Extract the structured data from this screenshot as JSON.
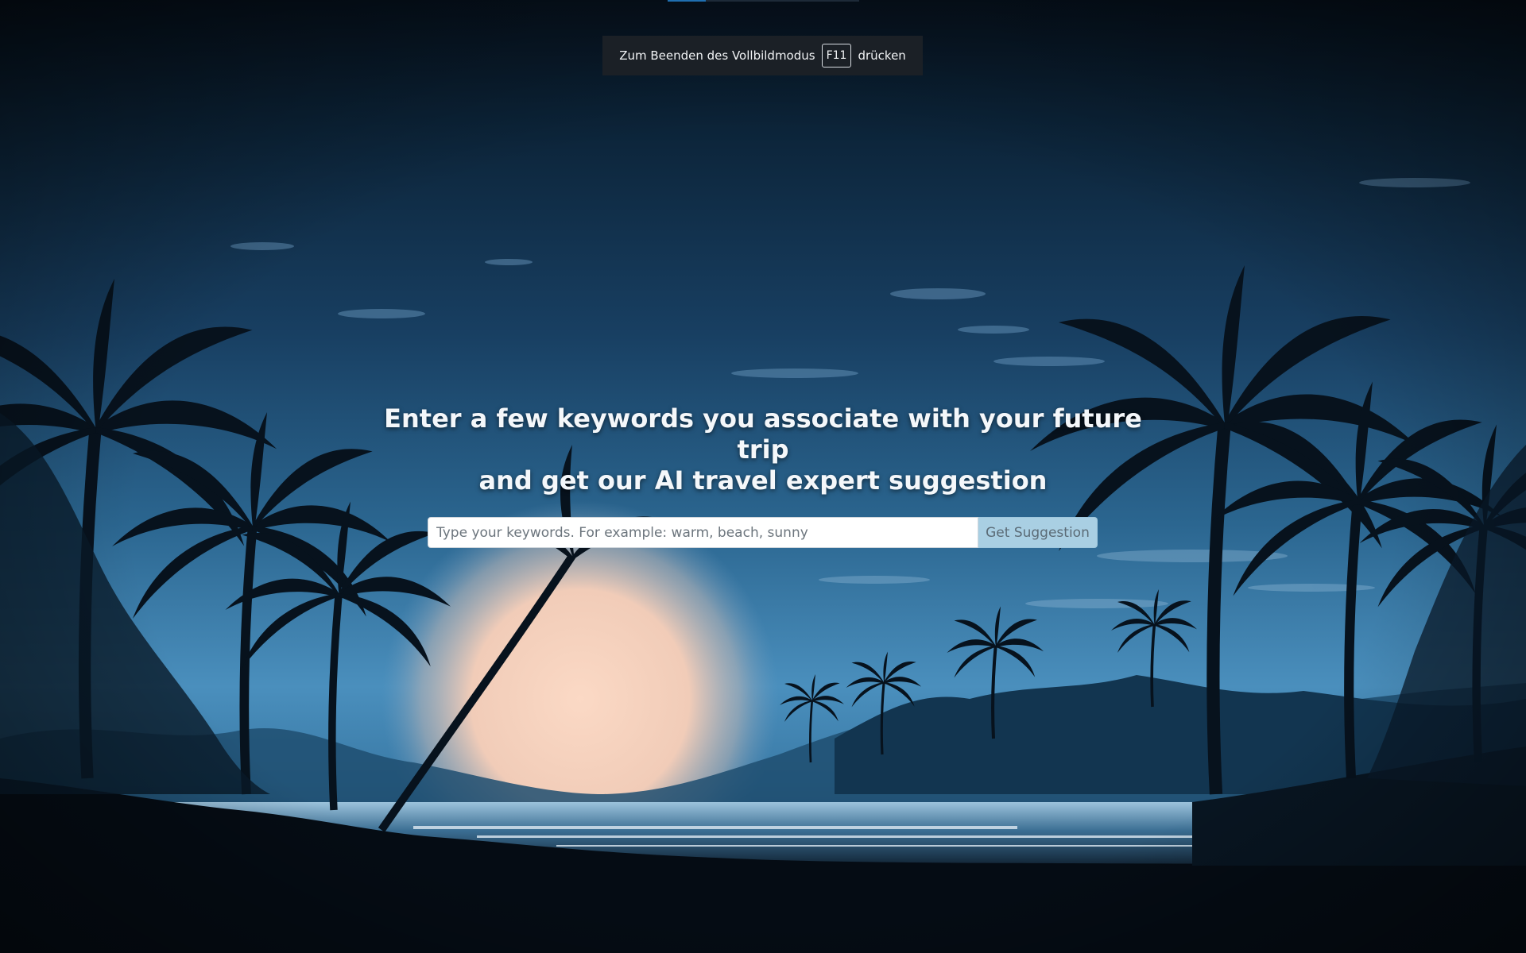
{
  "progress": {
    "fraction": 0.2
  },
  "fullscreen_notice": {
    "prefix": "Zum Beenden des Vollbildmodus",
    "key": "F11",
    "suffix": "drücken"
  },
  "hero": {
    "headline_line1": "Enter a few keywords you associate with your future trip",
    "headline_line2": "and get our AI travel expert suggestion"
  },
  "search": {
    "value": "",
    "placeholder": "Type your keywords. For example: warm, beach, sunny",
    "button_label": "Get Suggestion"
  },
  "colors": {
    "sky_top": "#06121f",
    "sky_mid": "#1a4a72",
    "sky_low": "#3d86b8",
    "sun_glow": "#f6d2bf",
    "button_bg": "#a9cfe3"
  },
  "background": {
    "description_icon": "tropical-night-beach-image"
  }
}
